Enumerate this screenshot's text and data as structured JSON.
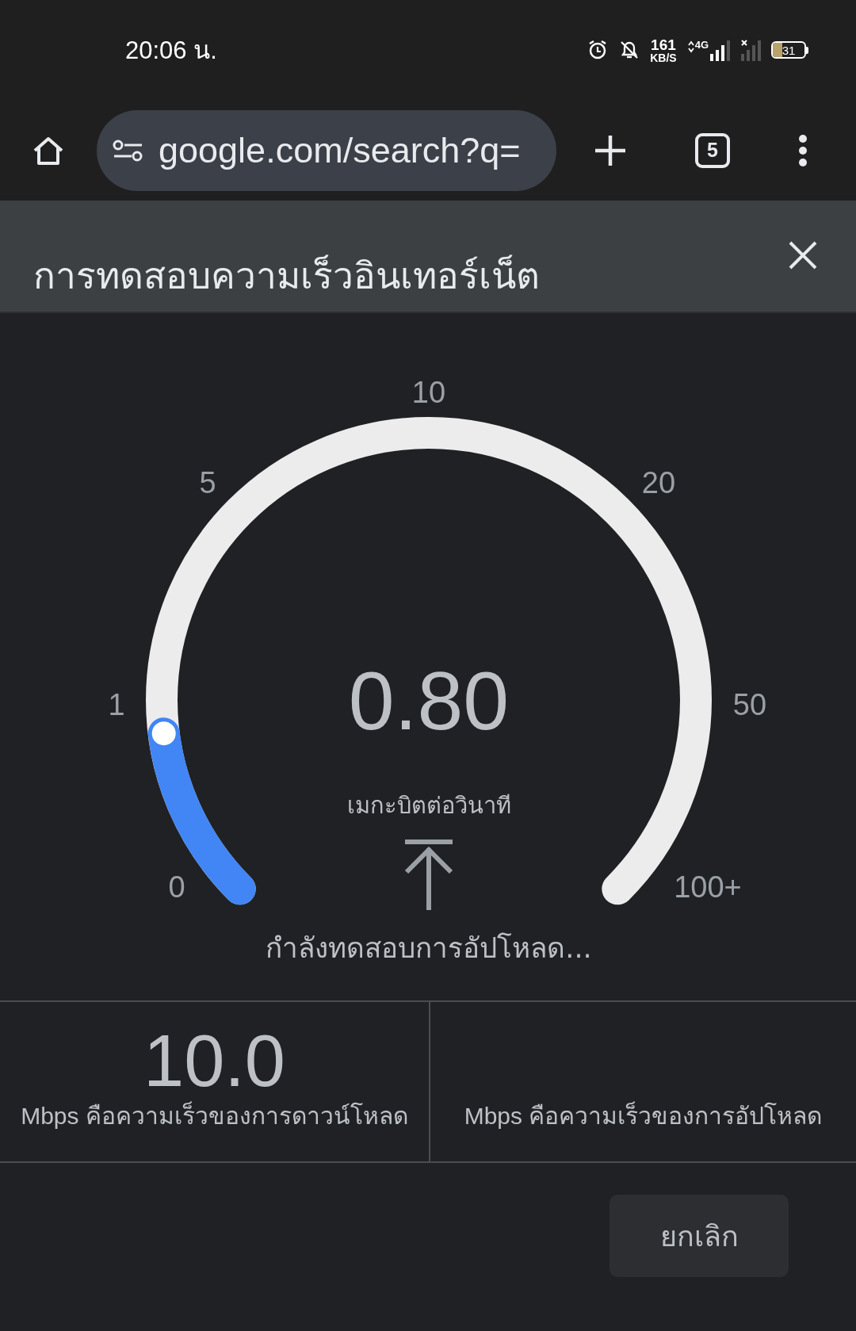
{
  "status_bar": {
    "time": "20:06 น.",
    "net_speed_value": "161",
    "net_speed_unit": "KB/S",
    "network": "4G",
    "battery": "31"
  },
  "browser": {
    "url": "google.com/search?q=",
    "tab_count": "5"
  },
  "panel": {
    "title": "การทดสอบความเร็วอินเทอร์เน็ต"
  },
  "gauge": {
    "ticks": [
      "0",
      "1",
      "5",
      "10",
      "20",
      "50",
      "100+"
    ],
    "reading": "0.80",
    "unit": "เมกะบิตต่อวินาที",
    "status": "กำลังทดสอบการอัปโหลด..."
  },
  "results": [
    {
      "value": "10.0",
      "label": "Mbps คือความเร็วของการดาวน์โหลด"
    },
    {
      "label": "Mbps คือความเร็วของการอัปโหลด"
    }
  ],
  "buttons": [
    {
      "label": "ยกเลิก"
    }
  ]
}
